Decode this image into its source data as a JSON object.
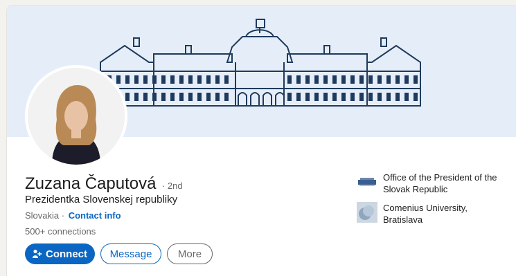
{
  "profile": {
    "name": "Zuzana Čaputová",
    "degree": "· 2nd",
    "headline": "Prezidentka Slovenskej republiky",
    "location": "Slovakia ·",
    "contact_info": "Contact info",
    "connections": "500+ connections"
  },
  "actions": {
    "connect_label": "Connect",
    "message_label": "Message",
    "more_label": "More"
  },
  "organizations": [
    {
      "name": "Office of the President of the Slovak Republic",
      "logo": "presidential-office-logo"
    },
    {
      "name": "Comenius University, Bratislava",
      "logo": "university-logo"
    }
  ],
  "colors": {
    "accent": "#0a66c2",
    "banner_bg": "#e5eef8",
    "banner_line": "#1f3a5c",
    "text_primary": "#1d1d1d",
    "text_secondary": "#666666"
  }
}
